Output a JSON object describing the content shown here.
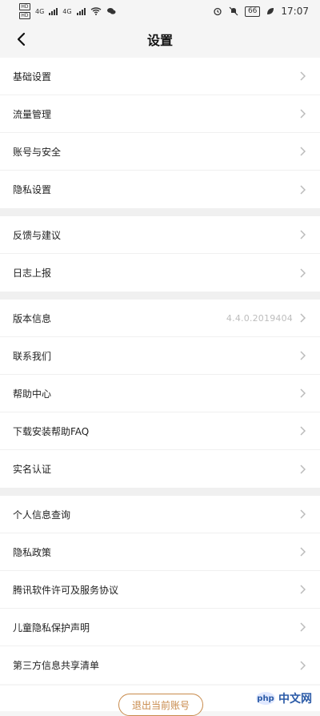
{
  "status_bar": {
    "time": "17:07",
    "sim1": "HD",
    "sim2": "HD",
    "network1": "4G",
    "network2": "4G",
    "battery": "66"
  },
  "header": {
    "title": "设置"
  },
  "groups": [
    [
      {
        "label": "基础设置"
      },
      {
        "label": "流量管理"
      },
      {
        "label": "账号与安全"
      },
      {
        "label": "隐私设置"
      }
    ],
    [
      {
        "label": "反馈与建议"
      },
      {
        "label": "日志上报"
      }
    ],
    [
      {
        "label": "版本信息",
        "value": "4.4.0.2019404"
      },
      {
        "label": "联系我们"
      },
      {
        "label": "帮助中心"
      },
      {
        "label": "下载安装帮助FAQ"
      },
      {
        "label": "实名认证"
      }
    ],
    [
      {
        "label": "个人信息查询"
      },
      {
        "label": "隐私政策"
      },
      {
        "label": "腾讯软件许可及服务协议"
      },
      {
        "label": "儿童隐私保护声明"
      },
      {
        "label": "第三方信息共享清单"
      }
    ]
  ],
  "logout_label": "退出当前账号",
  "watermark": {
    "brand": "php",
    "text": "中文网"
  },
  "colors": {
    "accent": "#c88a4b",
    "background": "#f5f5f5"
  }
}
